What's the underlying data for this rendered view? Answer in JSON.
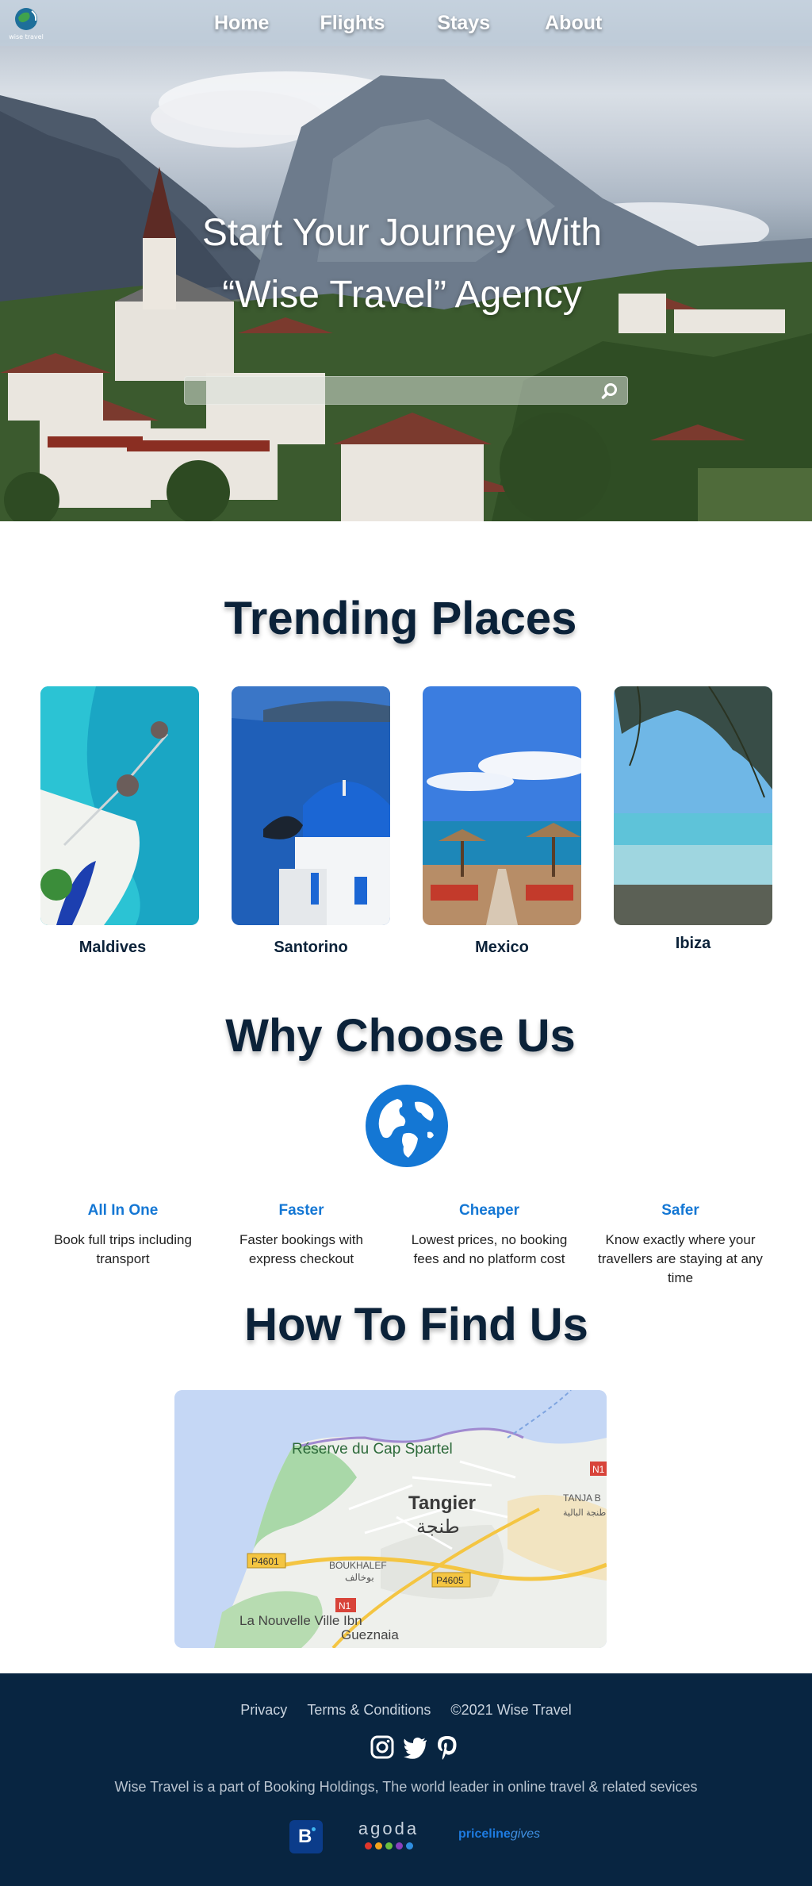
{
  "nav": {
    "logo_text": "wise travel",
    "links": [
      "Home",
      "Flights",
      "Stays",
      "About"
    ]
  },
  "hero": {
    "title_line1": "Start Your Journey With",
    "title_line2": "“Wise Travel” Agency",
    "search_placeholder": ""
  },
  "trending": {
    "title": "Trending Places",
    "places": [
      "Maldives",
      "Santorino",
      "Mexico",
      "Ibiza"
    ]
  },
  "why": {
    "title": "Why Choose Us",
    "features": [
      {
        "title": "All In One",
        "text": "Book full trips including transport"
      },
      {
        "title": "Faster",
        "text": "Faster bookings with express checkout"
      },
      {
        "title": "Cheaper",
        "text": "Lowest prices, no booking fees and no platform cost"
      },
      {
        "title": "Safer",
        "text": "Know exactly where your travellers are staying at any time"
      }
    ]
  },
  "find": {
    "title": "How To Find Us",
    "map_labels": {
      "reserve": "Réserve du Cap Spartel",
      "city": "Tangier",
      "city_ar": "طنجة",
      "boukhalef": "BOUKHALEF",
      "boukhalef_ar": "بوخالف",
      "road1": "P4601",
      "road2": "P4605",
      "road3": "N1",
      "road4": "N1",
      "nouvelle": "La Nouvelle Ville Ibn",
      "gueznaia": "Gueznaia",
      "tanja": "TANJA B",
      "tanja_ar": "طنجة البالية"
    }
  },
  "footer": {
    "links": [
      "Privacy",
      "Terms & Conditions",
      "©2021 Wise Travel"
    ],
    "note": "Wise Travel is a part of Booking Holdings, The world leader in online travel & related sevices",
    "partners": {
      "booking": "B",
      "agoda": "agoda",
      "priceline": "priceline",
      "gives": "gives"
    }
  },
  "colors": {
    "navy": "#0b2239",
    "accent": "#1477d4",
    "footer_bg": "#082541"
  }
}
